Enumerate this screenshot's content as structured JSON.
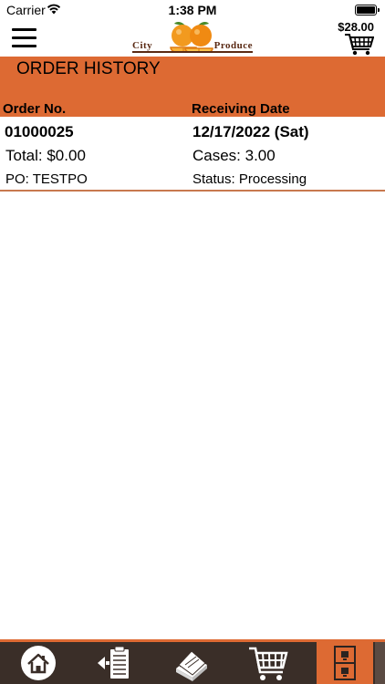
{
  "status_bar": {
    "carrier": "Carrier",
    "time": "1:38 PM"
  },
  "header": {
    "logo_left": "City",
    "logo_right": "Produce",
    "cart_total": "$28.00",
    "icons": [
      "menu-icon",
      "cart-icon"
    ]
  },
  "section": {
    "title": "ORDER HISTORY",
    "col_order": "Order No.",
    "col_date": "Receiving Date"
  },
  "orders": [
    {
      "number": "01000025",
      "total": "Total: $0.00",
      "po": "PO: TESTPO",
      "date": "12/17/2022 (Sat)",
      "cases": "Cases: 3.00",
      "status": "Status: Processing"
    }
  ],
  "tab_bar": {
    "tabs": [
      "home-icon",
      "order-list-icon",
      "catalog-book-icon",
      "cart-icon",
      "order-history-icon"
    ],
    "active_index": 4
  },
  "colors": {
    "accent": "#dd6a33",
    "tab_bar": "#3a2e28",
    "logo_brown": "#5a2a14"
  }
}
